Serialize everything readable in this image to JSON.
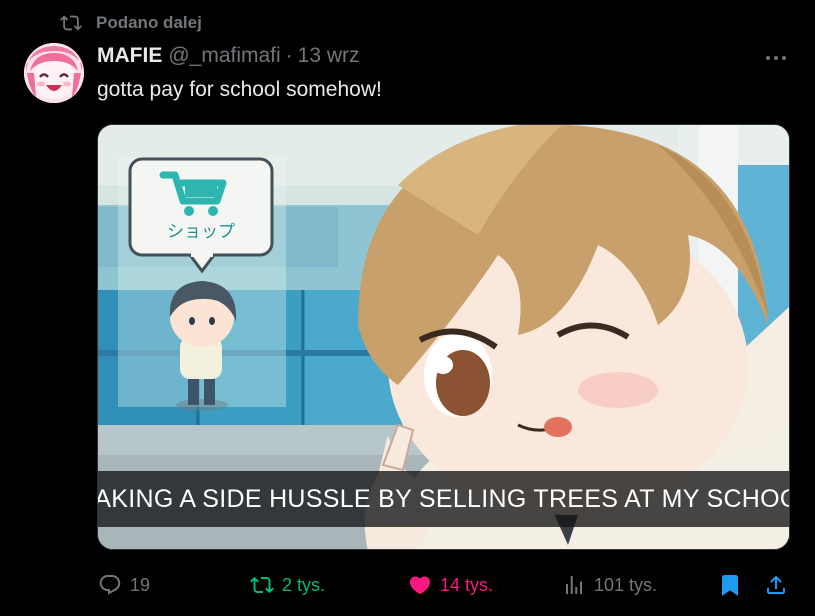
{
  "social_context": {
    "label": "Podano dalej"
  },
  "author": {
    "display_name": "MAFIE",
    "handle": "@_mafimafi",
    "separator": "·",
    "date": "13 wrz"
  },
  "tweet": {
    "text": "gotta pay for school somehow!"
  },
  "media": {
    "caption": "MAKING A SIDE HUSSLE BY SELLING TREES AT MY SCHOOL",
    "sign_text": "ショップ"
  },
  "actions": {
    "replies": "19",
    "retweets": "2 tys.",
    "likes": "14 tys.",
    "views": "101 tys."
  },
  "icons": {
    "retweet": "retweet-icon",
    "more": "more-icon",
    "reply": "reply-icon",
    "like": "heart-icon",
    "views": "views-icon",
    "bookmark": "bookmark-icon",
    "share": "share-icon",
    "cart": "shopping-cart-icon"
  },
  "colors": {
    "background": "#000000",
    "text_primary": "#e7e9ea",
    "text_secondary": "#71767b",
    "retweet_green": "#00ba7c",
    "like_pink": "#f91880",
    "bookmark_blue": "#1d9bf0",
    "shop_teal": "#2db5b0"
  }
}
